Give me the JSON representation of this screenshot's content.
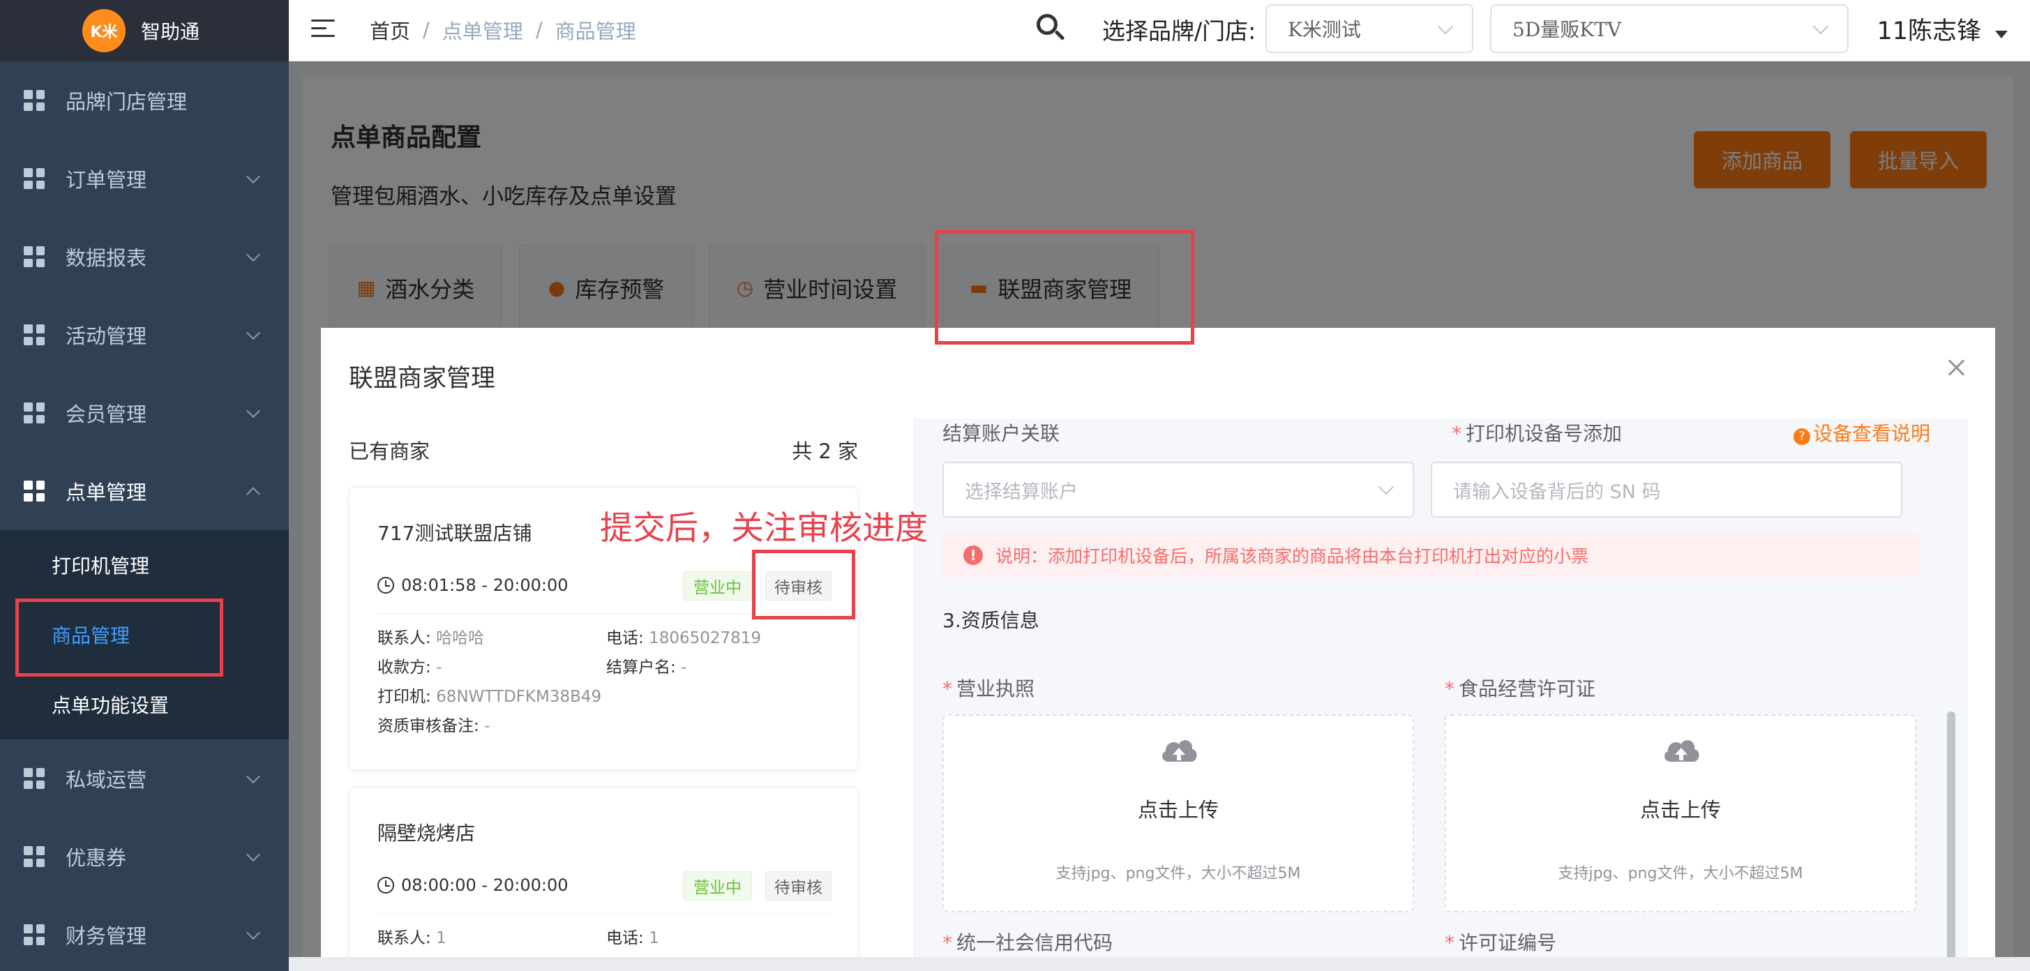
{
  "app": {
    "logo_badge": "K米",
    "name": "智助通"
  },
  "sidebar": {
    "items": [
      {
        "label": "品牌门店管理"
      },
      {
        "label": "订单管理"
      },
      {
        "label": "数据报表"
      },
      {
        "label": "活动管理"
      },
      {
        "label": "会员管理"
      },
      {
        "label": "点单管理"
      },
      {
        "label": "私域运营"
      },
      {
        "label": "优惠券"
      },
      {
        "label": "财务管理"
      }
    ],
    "submenu": [
      {
        "label": "打印机管理"
      },
      {
        "label": "商品管理"
      },
      {
        "label": "点单功能设置"
      }
    ]
  },
  "header": {
    "breadcrumb": [
      "首页",
      "点单管理",
      "商品管理"
    ],
    "breadcrumb_sep": "/",
    "brand_label": "选择品牌/门店:",
    "brand_select": "K米测试",
    "store_select": "5D量贩KTV",
    "user": "11陈志锋"
  },
  "page": {
    "title": "点单商品配置",
    "subtitle": "管理包厢酒水、小吃库存及点单设置",
    "add_button": "添加商品",
    "import_button": "批量导入",
    "tabs": [
      {
        "label": "酒水分类"
      },
      {
        "label": "库存预警"
      },
      {
        "label": "营业时间设置"
      },
      {
        "label": "联盟商家管理"
      }
    ]
  },
  "dialog": {
    "title": "联盟商家管理",
    "existing_label": "已有商家",
    "total": "共 2 家",
    "merchants": [
      {
        "name": "717测试联盟店铺",
        "time": "08:01:58 - 20:00:00",
        "status": "营业中",
        "review": "待审核",
        "contact_label": "联系人:",
        "contact": "哈哈哈",
        "phone_label": "电话:",
        "phone": "18065027819",
        "payee_label": "收款方:",
        "payee": "-",
        "account_label": "结算户名:",
        "account": "-",
        "printer_label": "打印机:",
        "printer": "68NWTTDFKM38B49",
        "remark_label": "资质审核备注:",
        "remark": "-"
      },
      {
        "name": "隔壁烧烤店",
        "time": "08:00:00 - 20:00:00",
        "status": "营业中",
        "review": "待审核",
        "contact_label": "联系人:",
        "contact": "1",
        "phone_label": "电话:",
        "phone": "1"
      }
    ],
    "form": {
      "settle_label": "结算账户关联",
      "settle_placeholder": "选择结算账户",
      "printer_label": "打印机设备号添加",
      "printer_placeholder": "请输入设备背后的 SN 码",
      "help_link": "设备查看说明",
      "alert": "说明：添加打印机设备后，所属该商家的商品将由本台打印机打出对应的小票",
      "section3": "3.资质信息",
      "license_label": "营业执照",
      "food_license_label": "食品经营许可证",
      "upload_text": "点击上传",
      "upload_tip": "支持jpg、png文件，大小不超过5M",
      "credit_code_label": "统一社会信用代码",
      "permit_no_label": "许可证编号"
    }
  },
  "annotation": "提交后，关注审核进度",
  "colors": {
    "accent": "#ff7a14",
    "highlight": "#e8414b",
    "sidebar": "#304156",
    "link": "#409eff"
  }
}
